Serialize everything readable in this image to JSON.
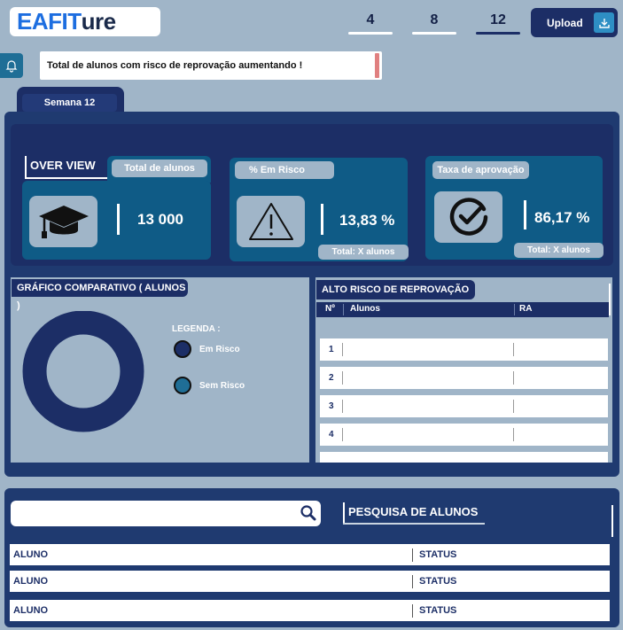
{
  "header": {
    "logo_part1": "EAFIT",
    "logo_part2": "ure",
    "weeks": [
      "4",
      "8",
      "12"
    ],
    "active_week": "12",
    "upload_label": "Upload"
  },
  "alert": {
    "text": "Total de alunos com risco de reprovação aumentando !"
  },
  "tab": {
    "label": "Semana 12"
  },
  "overview": {
    "title": "OVER VIEW",
    "cards": [
      {
        "label": "Total de alunos",
        "value": "13 000",
        "icon": "graduation-cap-icon"
      },
      {
        "label": "% Em Risco",
        "value": "13,83 %",
        "icon": "warning-icon",
        "total": "Total:  X alunos"
      },
      {
        "label": "Taxa de aprovação",
        "value": "86,17 %",
        "icon": "check-circle-icon",
        "total": "Total:  X alunos"
      }
    ]
  },
  "chart": {
    "title": "GRÁFICO COMPARATIVO ( ALUNOS )",
    "legend_title": "LEGENDA :",
    "legend": [
      {
        "label": "Em Risco",
        "color": "#1c2e66"
      },
      {
        "label": "Sem Risco",
        "color": "#1f6e96"
      }
    ]
  },
  "risk_table": {
    "title": "ALTO RISCO DE REPROVAÇÃO",
    "columns": [
      "Nº",
      "Alunos",
      "RA"
    ],
    "rows": [
      "1",
      "2",
      "3",
      "4"
    ]
  },
  "search": {
    "title": "PESQUISA DE ALUNOS",
    "placeholder": "",
    "rows": [
      {
        "aluno": "ALUNO",
        "status": "STATUS"
      },
      {
        "aluno": "ALUNO",
        "status": "STATUS"
      },
      {
        "aluno": "ALUNO",
        "status": "STATUS"
      }
    ]
  },
  "colors": {
    "bg": "#a0b5c8",
    "navy": "#1c2e66",
    "teal": "#0f5b86",
    "accent": "#1d6ee0",
    "alert": "#e08080"
  }
}
